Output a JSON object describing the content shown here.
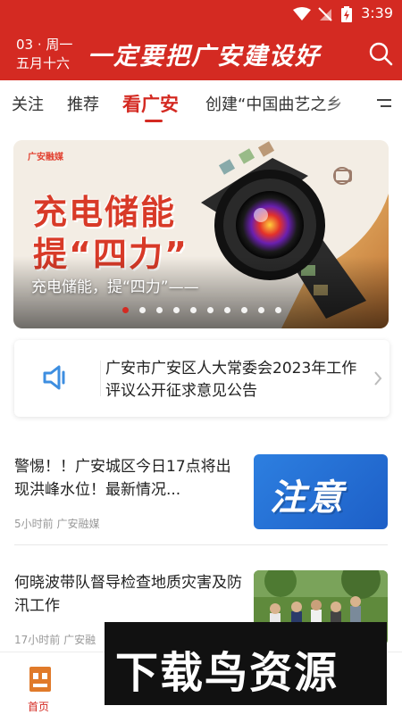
{
  "status_bar": {
    "time": "3:39"
  },
  "header": {
    "date_line1": "03 · 周一",
    "date_line2": "五月十六",
    "title": "一定要把广安建设好"
  },
  "tabs": [
    {
      "label": "关注",
      "active": false
    },
    {
      "label": "推荐",
      "active": false
    },
    {
      "label": "看广安",
      "active": true
    },
    {
      "label": "创建“中国曲艺之乡",
      "active": false
    }
  ],
  "banner": {
    "logo_text": "广安融媒",
    "big_line1": "充电储能",
    "big_line2": "提“四力”",
    "caption": "充电储能，提“四力”——",
    "slide_count": 10,
    "active_index": 0
  },
  "notice": {
    "text": "广安市广安区人大常委会2023年工作评议公开征求意见公告"
  },
  "news": [
    {
      "title": "警惕！！广安城区今日17点将出现洪峰水位！最新情况...",
      "meta": "5小时前  广安融媒",
      "thumb_text": "注意"
    },
    {
      "title": "何晓波带队督导检查地质灾害及防汛工作",
      "meta": "17小时前  广安融"
    }
  ],
  "bottom_nav": {
    "home_label": "首页"
  },
  "watermark": {
    "text": "下载鸟资源"
  },
  "colors": {
    "brand_red": "#d42a22",
    "accent_blue": "#2d7fe0"
  }
}
